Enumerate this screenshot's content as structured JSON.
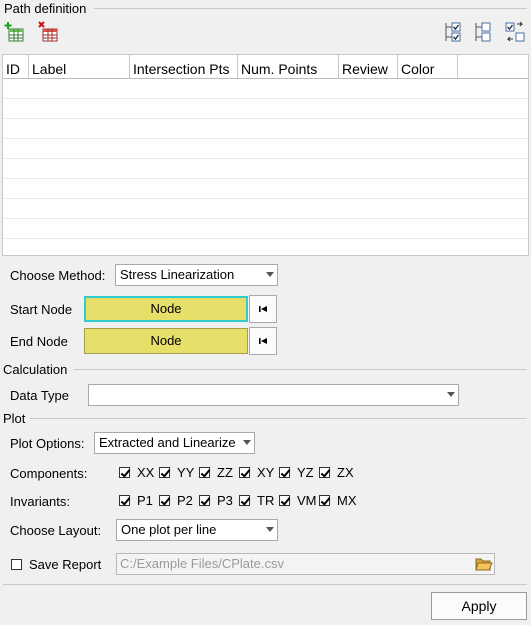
{
  "path_definition": {
    "title": "Path definition",
    "table": {
      "columns": [
        "ID",
        "Label",
        "Intersection Pts",
        "Num. Points",
        "Review",
        "Color"
      ],
      "rows": []
    }
  },
  "method": {
    "label": "Choose Method:",
    "value": "Stress Linearization"
  },
  "start_node": {
    "label": "Start Node",
    "button": "Node"
  },
  "end_node": {
    "label": "End Node",
    "button": "Node"
  },
  "calculation": {
    "title": "Calculation",
    "data_type_label": "Data Type",
    "data_type_value": ""
  },
  "plot": {
    "title": "Plot",
    "options_label": "Plot Options:",
    "options_value": "Extracted and Linearize",
    "components_label": "Components:",
    "components": [
      {
        "label": "XX",
        "checked": true
      },
      {
        "label": "YY",
        "checked": true
      },
      {
        "label": "ZZ",
        "checked": true
      },
      {
        "label": "XY",
        "checked": true
      },
      {
        "label": "YZ",
        "checked": true
      },
      {
        "label": "ZX",
        "checked": true
      }
    ],
    "invariants_label": "Invariants:",
    "invariants": [
      {
        "label": "P1",
        "checked": true
      },
      {
        "label": "P2",
        "checked": true
      },
      {
        "label": "P3",
        "checked": true
      },
      {
        "label": "TR",
        "checked": true
      },
      {
        "label": "VM",
        "checked": true
      },
      {
        "label": "MX",
        "checked": true
      }
    ],
    "layout_label": "Choose Layout:",
    "layout_value": "One plot per line"
  },
  "report": {
    "label": "Save Report",
    "checked": false,
    "path": "C:/Example Files/CPlate.csv"
  },
  "apply_label": "Apply",
  "icons": [
    "add-table-icon",
    "delete-table-icon",
    "check-list-icon",
    "tree-list-icon",
    "swap-check-icon",
    "first-record-icon",
    "folder-open-icon"
  ],
  "colors": {
    "node_button": "#e6e06a",
    "node_active_border": "#33cccc",
    "window_bg": "#f0f0f0"
  }
}
